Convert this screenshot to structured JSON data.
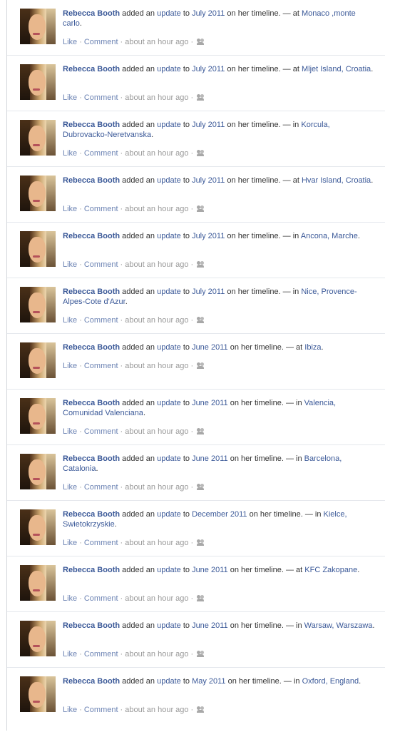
{
  "feed": {
    "items": [
      {
        "name": "Rebecca Booth",
        "added": "added an",
        "update": "update",
        "to": "to",
        "date": "July 2011",
        "rest": "on her timeline. — at",
        "place": "Monaco ,monte carlo",
        "end": "."
      },
      {
        "name": "Rebecca Booth",
        "added": "added an",
        "update": "update",
        "to": "to",
        "date": "July 2011",
        "rest": "on her timeline. — at",
        "place": "Mljet Island, Croatia",
        "end": "."
      },
      {
        "name": "Rebecca Booth",
        "added": "added an",
        "update": "update",
        "to": "to",
        "date": "July 2011",
        "rest": "on her timeline. — in",
        "place": "Korcula, Dubrovacko-Neretvanska",
        "end": "."
      },
      {
        "name": "Rebecca Booth",
        "added": "added an",
        "update": "update",
        "to": "to",
        "date": "July 2011",
        "rest": "on her timeline. — at",
        "place": "Hvar Island, Croatia",
        "end": "."
      },
      {
        "name": "Rebecca Booth",
        "added": "added an",
        "update": "update",
        "to": "to",
        "date": "July 2011",
        "rest": "on her timeline. — in",
        "place": "Ancona, Marche",
        "end": "."
      },
      {
        "name": "Rebecca Booth",
        "added": "added an",
        "update": "update",
        "to": "to",
        "date": "July 2011",
        "rest": "on her timeline. — in",
        "place": "Nice, Provence-Alpes-Cote d'Azur",
        "end": "."
      },
      {
        "name": "Rebecca Booth",
        "added": "added an",
        "update": "update",
        "to": "to",
        "date": "June 2011",
        "rest": "on her timeline. — at",
        "place": "Ibiza",
        "end": "."
      },
      {
        "name": "Rebecca Booth",
        "added": "added an",
        "update": "update",
        "to": "to",
        "date": "June 2011",
        "rest": "on her timeline. — in",
        "place": "Valencia, Comunidad Valenciana",
        "end": "."
      },
      {
        "name": "Rebecca Booth",
        "added": "added an",
        "update": "update",
        "to": "to",
        "date": "June 2011",
        "rest": "on her timeline. — in",
        "place": "Barcelona, Catalonia",
        "end": "."
      },
      {
        "name": "Rebecca Booth",
        "added": "added an",
        "update": "update",
        "to": "to",
        "date": "December 2011",
        "rest": "on her timeline. — in",
        "place": "Kielce, Swietokrzyskie",
        "end": "."
      },
      {
        "name": "Rebecca Booth",
        "added": "added an",
        "update": "update",
        "to": "to",
        "date": "June 2011",
        "rest": "on her timeline. — at",
        "place": "KFC Zakopane",
        "end": "."
      },
      {
        "name": "Rebecca Booth",
        "added": "added an",
        "update": "update",
        "to": "to",
        "date": "June 2011",
        "rest": "on her timeline. — in",
        "place": "Warsaw, Warszawa",
        "end": "."
      },
      {
        "name": "Rebecca Booth",
        "added": "added an",
        "update": "update",
        "to": "to",
        "date": "May 2011",
        "rest": "on her timeline. — in",
        "place": "Oxford, England",
        "end": "."
      }
    ],
    "like_label": "Like",
    "comment_label": "Comment",
    "separator": "·",
    "timestamp": "about an hour ago",
    "privacy_icon": "friends-icon"
  }
}
